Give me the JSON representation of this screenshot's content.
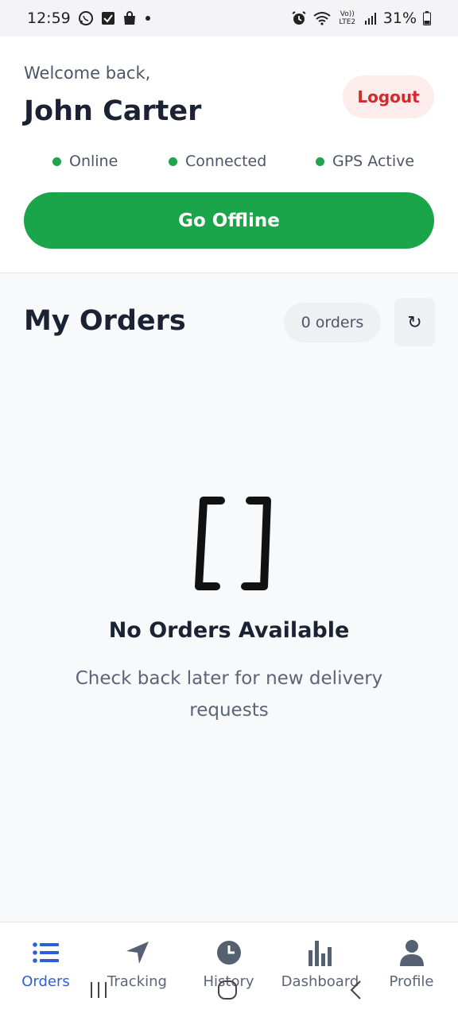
{
  "status_bar": {
    "time": "12:59",
    "signal_label": "Vo)) LTE2",
    "battery": "31%"
  },
  "header": {
    "welcome": "Welcome back,",
    "driver_name": "John Carter",
    "logout_label": "Logout",
    "statuses": [
      "Online",
      "Connected",
      "GPS Active"
    ],
    "go_offline_label": "Go Offline"
  },
  "orders": {
    "title": "My Orders",
    "count_label": "0 orders",
    "refresh_icon": "↻"
  },
  "empty_state": {
    "icon_text": "[ ]",
    "title": "No Orders Available",
    "subtitle": "Check back later for new delivery requests"
  },
  "nav": {
    "items": [
      {
        "label": "Orders",
        "icon": "list-icon",
        "active": true
      },
      {
        "label": "Tracking",
        "icon": "navigation-arrow-icon",
        "active": false
      },
      {
        "label": "History",
        "icon": "clock-icon",
        "active": false
      },
      {
        "label": "Dashboard",
        "icon": "bar-chart-icon",
        "active": false
      },
      {
        "label": "Profile",
        "icon": "user-icon",
        "active": false
      }
    ]
  },
  "colors": {
    "accent_green": "#1aa54b",
    "logout_red": "#d42a2a",
    "active_blue": "#2f5fd6"
  }
}
